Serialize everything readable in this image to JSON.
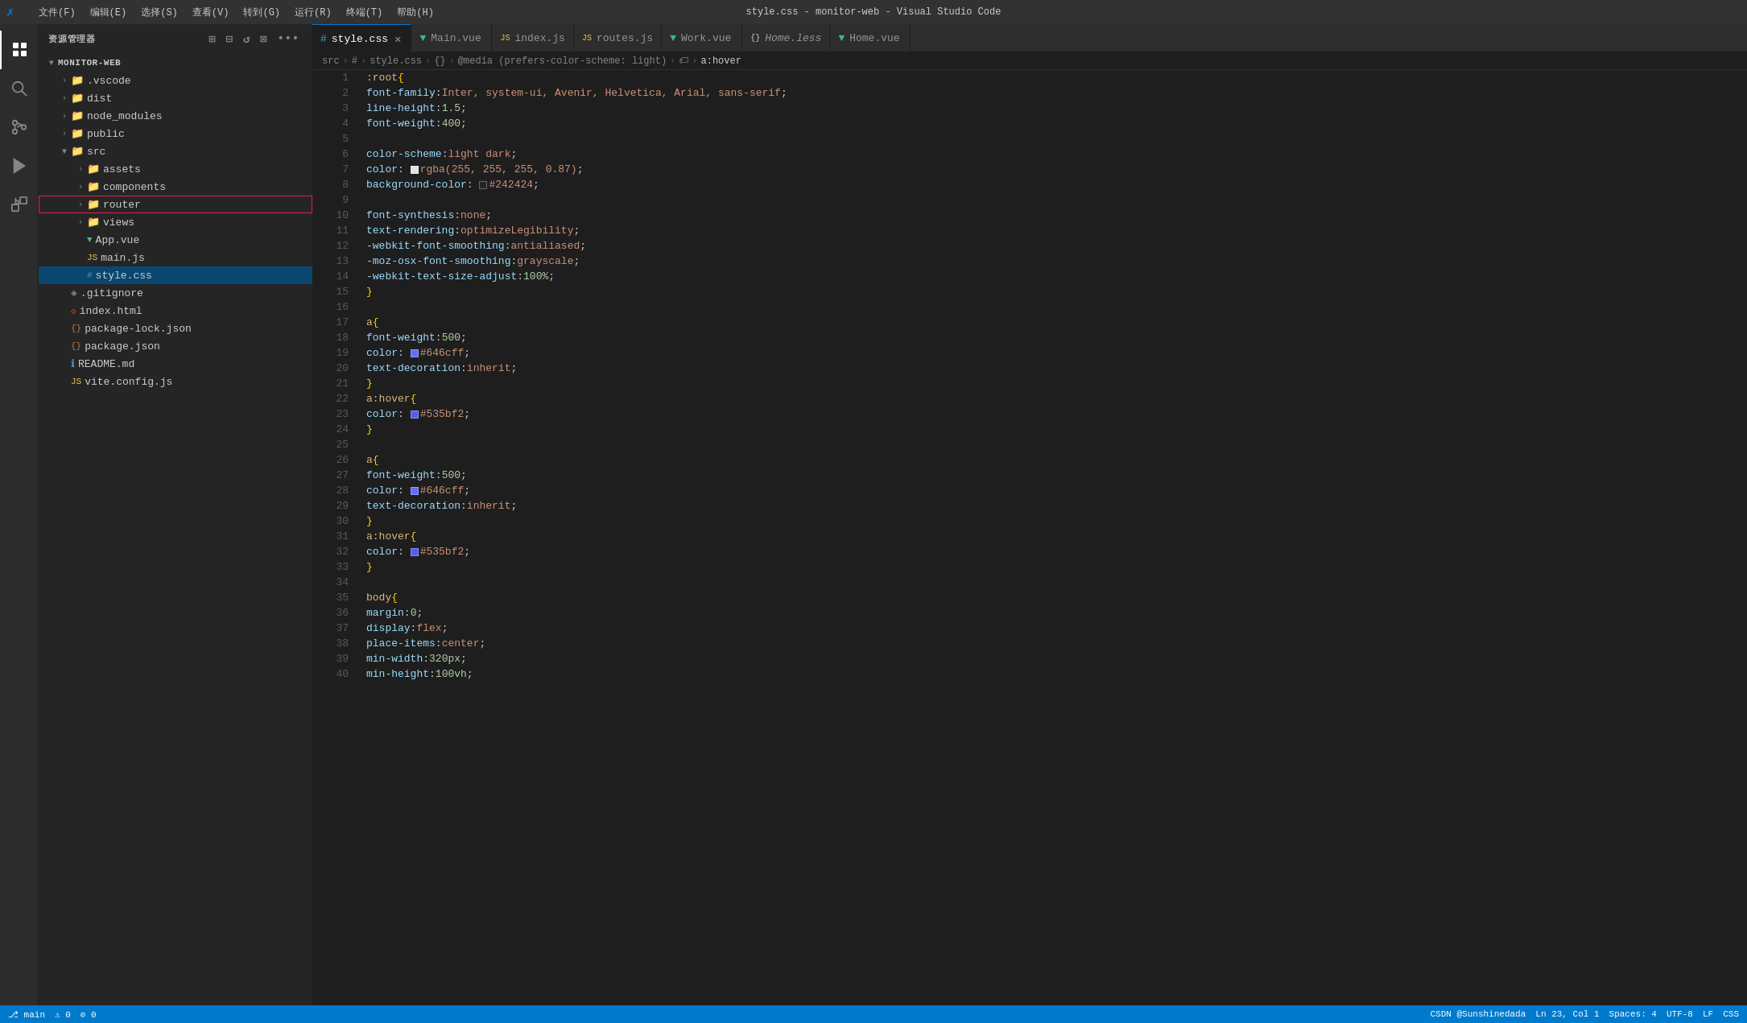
{
  "titleBar": {
    "title": "style.css - monitor-web - Visual Studio Code",
    "menu": [
      "文件(F)",
      "编辑(E)",
      "选择(S)",
      "查看(V)",
      "转到(G)",
      "运行(R)",
      "终端(T)",
      "帮助(H)"
    ]
  },
  "activityBar": {
    "icons": [
      {
        "name": "explorer-icon",
        "symbol": "⊞",
        "active": true
      },
      {
        "name": "search-icon",
        "symbol": "🔍",
        "active": false
      },
      {
        "name": "source-control-icon",
        "symbol": "⎇",
        "active": false
      },
      {
        "name": "run-icon",
        "symbol": "▷",
        "active": false
      },
      {
        "name": "extensions-icon",
        "symbol": "⊠",
        "active": false
      }
    ]
  },
  "sidebar": {
    "title": "资源管理器",
    "moreButton": "•••",
    "rootFolder": "MONITOR-WEB",
    "tree": [
      {
        "id": "vscode",
        "label": ".vscode",
        "type": "folder",
        "depth": 1,
        "collapsed": true
      },
      {
        "id": "dist",
        "label": "dist",
        "type": "folder",
        "depth": 1,
        "collapsed": true
      },
      {
        "id": "node_modules",
        "label": "node_modules",
        "type": "folder",
        "depth": 1,
        "collapsed": true
      },
      {
        "id": "public",
        "label": "public",
        "type": "folder",
        "depth": 1,
        "collapsed": true
      },
      {
        "id": "src",
        "label": "src",
        "type": "folder",
        "depth": 1,
        "collapsed": false
      },
      {
        "id": "assets",
        "label": "assets",
        "type": "folder",
        "depth": 2,
        "collapsed": true
      },
      {
        "id": "components",
        "label": "components",
        "type": "folder",
        "depth": 2,
        "collapsed": true
      },
      {
        "id": "router",
        "label": "router",
        "type": "folder",
        "depth": 2,
        "collapsed": true
      },
      {
        "id": "views",
        "label": "views",
        "type": "folder",
        "depth": 2,
        "collapsed": true
      },
      {
        "id": "App.vue",
        "label": "App.vue",
        "type": "vue",
        "depth": 2
      },
      {
        "id": "main.js",
        "label": "main.js",
        "type": "js",
        "depth": 2
      },
      {
        "id": "style.css",
        "label": "style.css",
        "type": "css",
        "depth": 2,
        "selected": true
      },
      {
        "id": "gitignore",
        "label": ".gitignore",
        "type": "gitignore",
        "depth": 1
      },
      {
        "id": "index.html",
        "label": "index.html",
        "type": "html",
        "depth": 1
      },
      {
        "id": "package-lock.json",
        "label": "package-lock.json",
        "type": "json",
        "depth": 1
      },
      {
        "id": "package.json",
        "label": "package.json",
        "type": "json",
        "depth": 1
      },
      {
        "id": "README.md",
        "label": "README.md",
        "type": "md",
        "depth": 1
      },
      {
        "id": "vite.config.js",
        "label": "vite.config.js",
        "type": "js",
        "depth": 1
      }
    ]
  },
  "tabs": [
    {
      "label": "style.css",
      "type": "css",
      "active": true,
      "closable": true
    },
    {
      "label": "Main.vue",
      "type": "vue",
      "active": false,
      "closable": false
    },
    {
      "label": "index.js",
      "type": "js",
      "active": false,
      "closable": false
    },
    {
      "label": "routes.js",
      "type": "js",
      "active": false,
      "closable": false
    },
    {
      "label": "Work.vue",
      "type": "vue",
      "active": false,
      "closable": false
    },
    {
      "label": "Home.less",
      "type": "less",
      "active": false,
      "closable": false
    },
    {
      "label": "Home.vue",
      "type": "vue",
      "active": false,
      "closable": false
    }
  ],
  "breadcrumb": {
    "items": [
      "src",
      "#",
      "style.css",
      "{}",
      "@media (prefers-color-scheme: light)",
      ">",
      "🏷",
      "a:hover"
    ]
  },
  "code": {
    "lines": [
      {
        "num": 1,
        "content": ":root {"
      },
      {
        "num": 2,
        "content": "    font-family: Inter, system-ui, Avenir, Helvetica, Arial, sans-serif;"
      },
      {
        "num": 3,
        "content": "    line-height: 1.5;"
      },
      {
        "num": 4,
        "content": "    font-weight: 400;"
      },
      {
        "num": 5,
        "content": ""
      },
      {
        "num": 6,
        "content": "    color-scheme: light dark;"
      },
      {
        "num": 7,
        "content": "    color: [sw:#rgba_white]rgba(255, 255, 255, 0.87);"
      },
      {
        "num": 8,
        "content": "    background-color: [sw:#242424]#242424;"
      },
      {
        "num": 9,
        "content": ""
      },
      {
        "num": 10,
        "content": "    font-synthesis: none;"
      },
      {
        "num": 11,
        "content": "    text-rendering: optimizeLegibility;"
      },
      {
        "num": 12,
        "content": "    -webkit-font-smoothing: antialiased;"
      },
      {
        "num": 13,
        "content": "    -moz-osx-font-smoothing: grayscale;"
      },
      {
        "num": 14,
        "content": "    -webkit-text-size-adjust: 100%;"
      },
      {
        "num": 15,
        "content": "}"
      },
      {
        "num": 16,
        "content": ""
      },
      {
        "num": 17,
        "content": "a {"
      },
      {
        "num": 18,
        "content": "    font-weight: 500;"
      },
      {
        "num": 19,
        "content": "    color: [sw:#646cff]#646cff;"
      },
      {
        "num": 20,
        "content": "    text-decoration: inherit;"
      },
      {
        "num": 21,
        "content": "}"
      },
      {
        "num": 22,
        "content": "a:hover {"
      },
      {
        "num": 23,
        "content": "    color: [sw:#535bf2]#535bf2;"
      },
      {
        "num": 24,
        "content": "}"
      },
      {
        "num": 25,
        "content": ""
      },
      {
        "num": 26,
        "content": "a {"
      },
      {
        "num": 27,
        "content": "    font-weight: 500;"
      },
      {
        "num": 28,
        "content": "    color: [sw:#646cff]#646cff;"
      },
      {
        "num": 29,
        "content": "    text-decoration: inherit;"
      },
      {
        "num": 30,
        "content": "}"
      },
      {
        "num": 31,
        "content": "a:hover {"
      },
      {
        "num": 32,
        "content": "    color: [sw:#535bf2]#535bf2;"
      },
      {
        "num": 33,
        "content": "}"
      },
      {
        "num": 34,
        "content": ""
      },
      {
        "num": 35,
        "content": "body {"
      },
      {
        "num": 36,
        "content": "    margin: 0;"
      },
      {
        "num": 37,
        "content": "    display: flex;"
      },
      {
        "num": 38,
        "content": "    place-items: center;"
      },
      {
        "num": 39,
        "content": "    min-width: 320px;"
      },
      {
        "num": 40,
        "content": "    min-height: 100vh;"
      }
    ]
  },
  "statusBar": {
    "left": [
      "⎇ main",
      "⚠ 0",
      "⊘ 0"
    ],
    "right": [
      "CSDN @Sunshinedada",
      "Ln 23, Col 1",
      "Spaces: 4",
      "UTF-8",
      "LF",
      "CSS"
    ]
  },
  "colors": {
    "accent": "#007acc",
    "bg_editor": "#1e1e1e",
    "bg_sidebar": "#252526",
    "bg_tab_active": "#1e1e1e",
    "bg_tab_inactive": "#2d2d2d",
    "selected_file_bg": "#094771"
  }
}
